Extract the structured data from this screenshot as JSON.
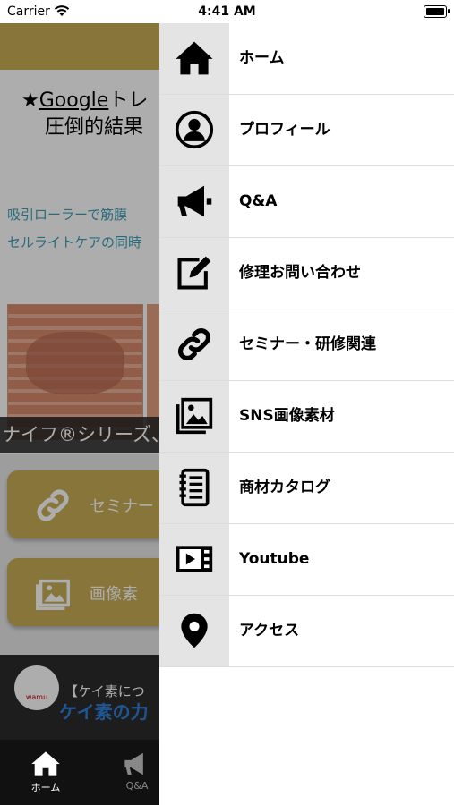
{
  "status_bar": {
    "carrier": "Carrier",
    "time": "4:41 AM"
  },
  "background": {
    "title_line1_prefix": "★",
    "title_line1_word": "Google",
    "title_line1_rest": "トレ",
    "title_line2": "圧倒的結果",
    "text_line1": "吸引ローラーで筋膜",
    "text_line2": "セルライトケアの同時",
    "strip_text": "ナイフ®シリーズ、",
    "button1_label": "セミナー",
    "button2_label": "画像素",
    "banner_text": "【ケイ素につ",
    "banner_text2": "ケイ素の力",
    "banner_logo": "wamu"
  },
  "tabbar": {
    "items": [
      {
        "label": "ホーム",
        "icon": "home-icon",
        "active": true
      },
      {
        "label": "Q&A",
        "icon": "megaphone-icon",
        "active": false
      }
    ]
  },
  "drawer": {
    "items": [
      {
        "label": "ホーム",
        "icon": "home-icon"
      },
      {
        "label": "プロフィール",
        "icon": "profile-icon"
      },
      {
        "label": "Q&A",
        "icon": "megaphone-icon"
      },
      {
        "label": "修理お問い合わせ",
        "icon": "edit-icon"
      },
      {
        "label": "セミナー・研修関連",
        "icon": "link-icon"
      },
      {
        "label": "SNS画像素材",
        "icon": "images-icon"
      },
      {
        "label": "商材カタログ",
        "icon": "notebook-icon"
      },
      {
        "label": "Youtube",
        "icon": "video-icon"
      },
      {
        "label": "アクセス",
        "icon": "map-pin-icon"
      }
    ]
  },
  "colors": {
    "accent_gold": "#c8ad56",
    "icon_bg": "#e4e4e4",
    "overlay": "rgba(0,0,0,0.32)"
  }
}
